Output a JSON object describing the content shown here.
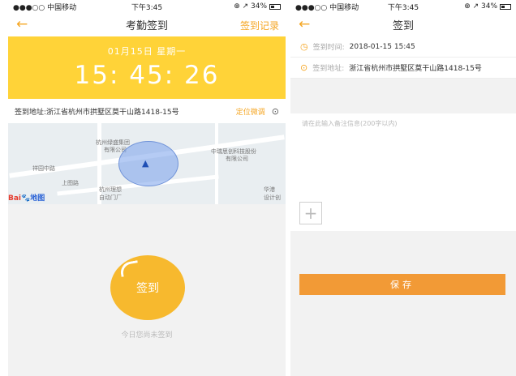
{
  "left": {
    "status": {
      "carrier": "●●●○○ 中国移动",
      "wifi": "ᯤ",
      "time": "下午3:45",
      "battery": "⊕ ↗ 34%"
    },
    "nav": {
      "back": "←",
      "title": "考勤签到",
      "record": "签到记录"
    },
    "hero": {
      "date": "01月15日  星期一",
      "time": "15: 45: 26"
    },
    "address": {
      "label": "签到地址:浙江省杭州市拱墅区莫干山路1418-15号",
      "fix": "定位微调"
    },
    "map": {
      "labels": [
        "杭州绿盛集团",
        "有限公司",
        "祥园中路",
        "上图路",
        "杭州理想",
        "自动门厂",
        "中瑞思创科技股份",
        "有限公司",
        "华港",
        "设计创"
      ],
      "logo_a": "Bai",
      "logo_b": "地图"
    },
    "checkin": {
      "button": "签到",
      "status": "今日您尚未签到"
    }
  },
  "right": {
    "status": {
      "carrier": "●●●○○ 中国移动",
      "wifi": "ᯤ",
      "time": "下午3:45",
      "battery": "⊕ ↗ 34%"
    },
    "nav": {
      "back": "←",
      "title": "签到"
    },
    "time_row": {
      "key": "签到时间:",
      "value": "2018-01-15 15:45"
    },
    "addr_row": {
      "key": "签到地址:",
      "value": "浙江省杭州市拱墅区莫干山路1418-15号"
    },
    "note": {
      "placeholder": "请在此输入备注信息(200字以内)"
    },
    "add": "+",
    "save": "保存"
  },
  "colors": {
    "accent": "#f5a623",
    "hero": "#ffd338",
    "save": "#f29a36"
  }
}
